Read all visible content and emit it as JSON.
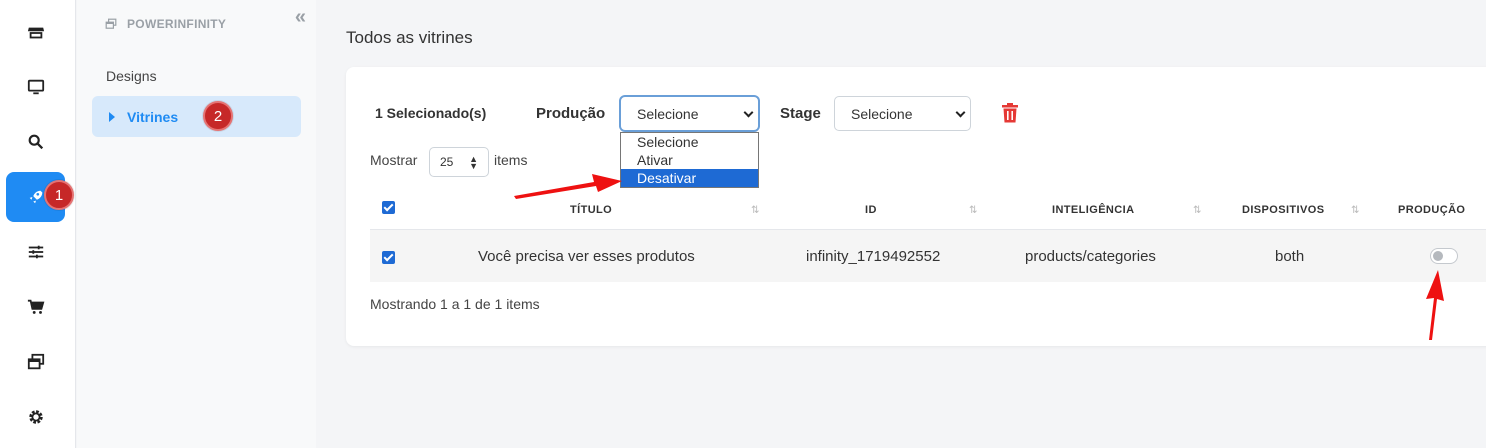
{
  "rail": {
    "items": [
      {
        "icon": "store-icon",
        "active": false
      },
      {
        "icon": "monitor-icon",
        "active": false
      },
      {
        "icon": "search-icon",
        "active": false
      },
      {
        "icon": "rocket-icon",
        "active": true
      },
      {
        "icon": "sliders-icon",
        "active": false
      },
      {
        "icon": "cart-icon",
        "active": false
      },
      {
        "icon": "windows-icon",
        "active": false
      },
      {
        "icon": "gear-icon",
        "active": false
      }
    ],
    "badge": "1"
  },
  "sidebar": {
    "brand": "POWERINFINITY",
    "designs": "Designs",
    "vitrines": "Vitrines",
    "badge": "2"
  },
  "main": {
    "title": "Todos as vitrines",
    "selected_count": "1 Selecionado(s)",
    "producao_label": "Produção",
    "producao_value": "Selecione",
    "producao_options": [
      "Selecione",
      "Ativar",
      "Desativar"
    ],
    "stage_label": "Stage",
    "stage_value": "Selecione",
    "show_label": "Mostrar",
    "page_size": "25",
    "items_label": "items",
    "columns": [
      "TÍTULO",
      "ID",
      "INTELIGÊNCIA",
      "DISPOSITIVOS",
      "PRODUÇÃO"
    ],
    "rows": [
      {
        "titulo": "Você precisa ver esses produtos",
        "id": "infinity_1719492552",
        "inteligencia": "products/categories",
        "dispositivos": "both",
        "producao": false,
        "selected": true
      }
    ],
    "footer": "Mostrando 1 a 1 de 1 items"
  },
  "colors": {
    "accent": "#1f8bf3",
    "badge": "#c62828",
    "danger": "#e53935",
    "annotation_arrow": "#ee1111"
  }
}
